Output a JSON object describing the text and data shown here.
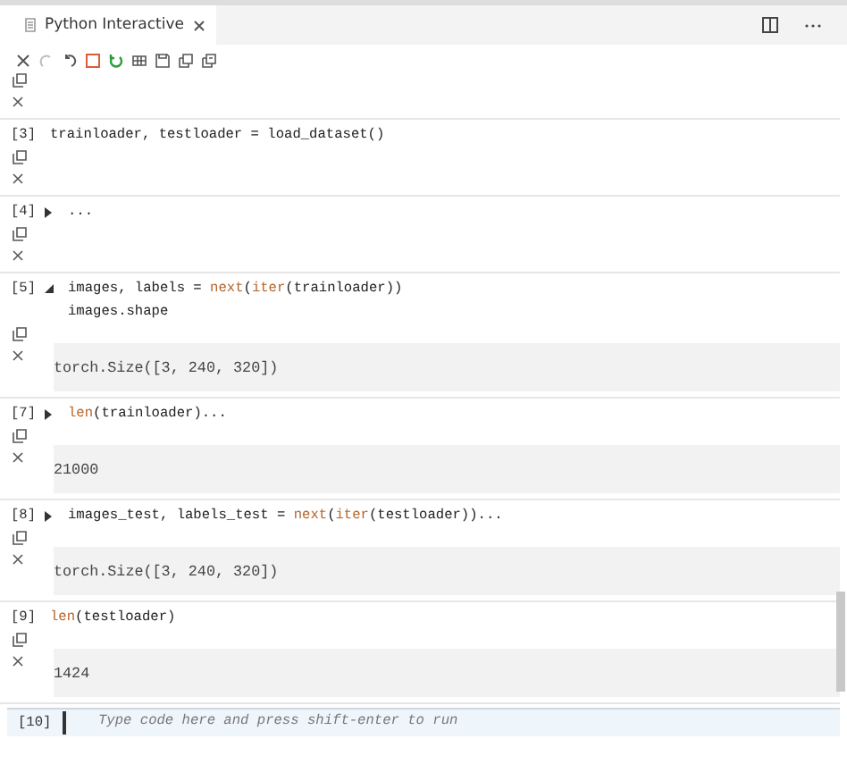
{
  "tab": {
    "title": "Python Interactive",
    "selected": true
  },
  "cells": [
    {},
    {
      "prompt": "[3]",
      "code": [
        [
          {
            "text": "trainloader, testloader = load_dataset()",
            "kind": "plain"
          }
        ]
      ]
    },
    {
      "prompt": "[4]",
      "expanded": false,
      "code": [
        [
          {
            "text": "...",
            "kind": "plain"
          }
        ]
      ]
    },
    {
      "prompt": "[5]",
      "expanded": true,
      "code": [
        [
          {
            "text": "images, labels = ",
            "kind": "plain"
          },
          {
            "text": "next",
            "kind": "builtin"
          },
          {
            "text": "(",
            "kind": "plain"
          },
          {
            "text": "iter",
            "kind": "builtin"
          },
          {
            "text": "(trainloader))",
            "kind": "plain"
          }
        ],
        [
          {
            "text": "images.shape",
            "kind": "plain"
          }
        ]
      ],
      "output": "torch.Size([3, 240, 320])"
    },
    {
      "prompt": "[7]",
      "expanded": false,
      "code": [
        [
          {
            "text": "len",
            "kind": "builtin"
          },
          {
            "text": "(trainloader)...",
            "kind": "plain"
          }
        ]
      ],
      "output": "21000"
    },
    {
      "prompt": "[8]",
      "expanded": false,
      "code": [
        [
          {
            "text": "images_test, labels_test = ",
            "kind": "plain"
          },
          {
            "text": "next",
            "kind": "builtin"
          },
          {
            "text": "(",
            "kind": "plain"
          },
          {
            "text": "iter",
            "kind": "builtin"
          },
          {
            "text": "(testloader))...",
            "kind": "plain"
          }
        ]
      ],
      "output": "torch.Size([3, 240, 320])"
    },
    {
      "prompt": "[9]",
      "code": [
        [
          {
            "text": "len",
            "kind": "builtin"
          },
          {
            "text": "(testloader)",
            "kind": "plain"
          }
        ]
      ],
      "output": "1424"
    }
  ],
  "input": {
    "prompt": "[10]",
    "placeholder": "Type code here and press shift-enter to run"
  }
}
